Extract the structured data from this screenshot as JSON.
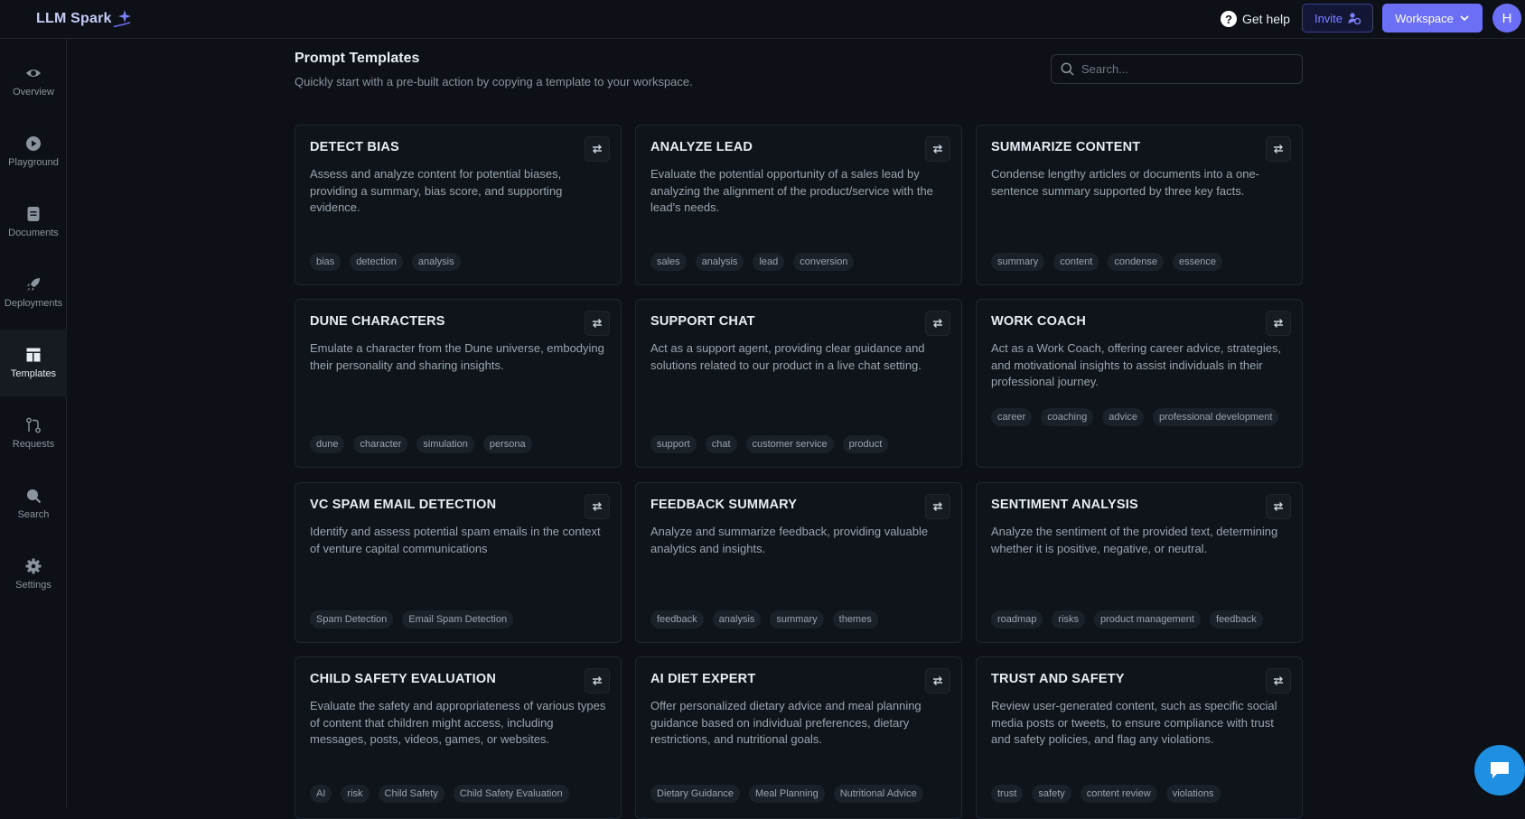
{
  "app": {
    "logo_text_a": "LLM",
    "logo_text_b": "Spark"
  },
  "topbar": {
    "help_label": "Get help",
    "invite_label": "Invite",
    "workspace_label": "Workspace",
    "avatar_initial": "H"
  },
  "sidebar": {
    "items": [
      {
        "label": "Overview",
        "icon": "eye-icon"
      },
      {
        "label": "Playground",
        "icon": "play-icon"
      },
      {
        "label": "Documents",
        "icon": "document-icon"
      },
      {
        "label": "Deployments",
        "icon": "rocket-icon"
      },
      {
        "label": "Templates",
        "icon": "templates-icon",
        "active": true
      },
      {
        "label": "Requests",
        "icon": "requests-icon"
      },
      {
        "label": "Search",
        "icon": "search-icon"
      },
      {
        "label": "Settings",
        "icon": "gear-icon"
      }
    ]
  },
  "page": {
    "title": "Prompt Templates",
    "subtitle": "Quickly start with a pre-built action by copying a template to your workspace.",
    "search_placeholder": "Search..."
  },
  "templates": [
    {
      "title": "DETECT BIAS",
      "desc": "Assess and analyze content for potential biases, providing a summary, bias score, and supporting evidence.",
      "tags": [
        "bias",
        "detection",
        "analysis"
      ]
    },
    {
      "title": "ANALYZE LEAD",
      "desc": "Evaluate the potential opportunity of a sales lead by analyzing the alignment of the product/service with the lead's needs.",
      "tags": [
        "sales",
        "analysis",
        "lead",
        "conversion"
      ]
    },
    {
      "title": "SUMMARIZE CONTENT",
      "desc": "Condense lengthy articles or documents into a one-sentence summary supported by three key facts.",
      "tags": [
        "summary",
        "content",
        "condense",
        "essence"
      ]
    },
    {
      "title": "DUNE CHARACTERS",
      "desc": "Emulate a character from the Dune universe, embodying their personality and sharing insights.",
      "tags": [
        "dune",
        "character",
        "simulation",
        "persona"
      ]
    },
    {
      "title": "SUPPORT CHAT",
      "desc": "Act as a support agent, providing clear guidance and solutions related to our product in a live chat setting.",
      "tags": [
        "support",
        "chat",
        "customer service",
        "product"
      ]
    },
    {
      "title": "WORK COACH",
      "desc": "Act as a Work Coach, offering career advice, strategies, and motivational insights to assist individuals in their professional journey.",
      "tags": [
        "career",
        "coaching",
        "advice",
        "professional development"
      ]
    },
    {
      "title": "VC SPAM EMAIL DETECTION",
      "desc": "Identify and assess potential spam emails in the context of venture capital communications",
      "tags": [
        "Spam Detection",
        "Email Spam Detection"
      ]
    },
    {
      "title": "FEEDBACK SUMMARY",
      "desc": "Analyze and summarize feedback, providing valuable analytics and insights.",
      "tags": [
        "feedback",
        "analysis",
        "summary",
        "themes"
      ]
    },
    {
      "title": "SENTIMENT ANALYSIS",
      "desc": "Analyze the sentiment of the provided text, determining whether it is positive, negative, or neutral.",
      "tags": [
        "roadmap",
        "risks",
        "product management",
        "feedback"
      ]
    },
    {
      "title": "CHILD SAFETY EVALUATION",
      "desc": "Evaluate the safety and appropriateness of various types of content that children might access, including messages, posts, videos, games, or websites.",
      "tags": [
        "AI",
        "risk",
        "Child Safety",
        "Child Safety Evaluation"
      ]
    },
    {
      "title": "AI DIET EXPERT",
      "desc": "Offer personalized dietary advice and meal planning guidance based on individual preferences, dietary restrictions, and nutritional goals.",
      "tags": [
        "Dietary Guidance",
        "Meal Planning",
        "Nutritional Advice"
      ]
    },
    {
      "title": "TRUST AND SAFETY",
      "desc": "Review user-generated content, such as specific social media posts or tweets, to ensure compliance with trust and safety policies, and flag any violations.",
      "tags": [
        "trust",
        "safety",
        "content review",
        "violations"
      ]
    }
  ],
  "colors": {
    "accent": "#6b6ff5",
    "background": "#0d1117",
    "chat_button": "#1e8fe1"
  }
}
